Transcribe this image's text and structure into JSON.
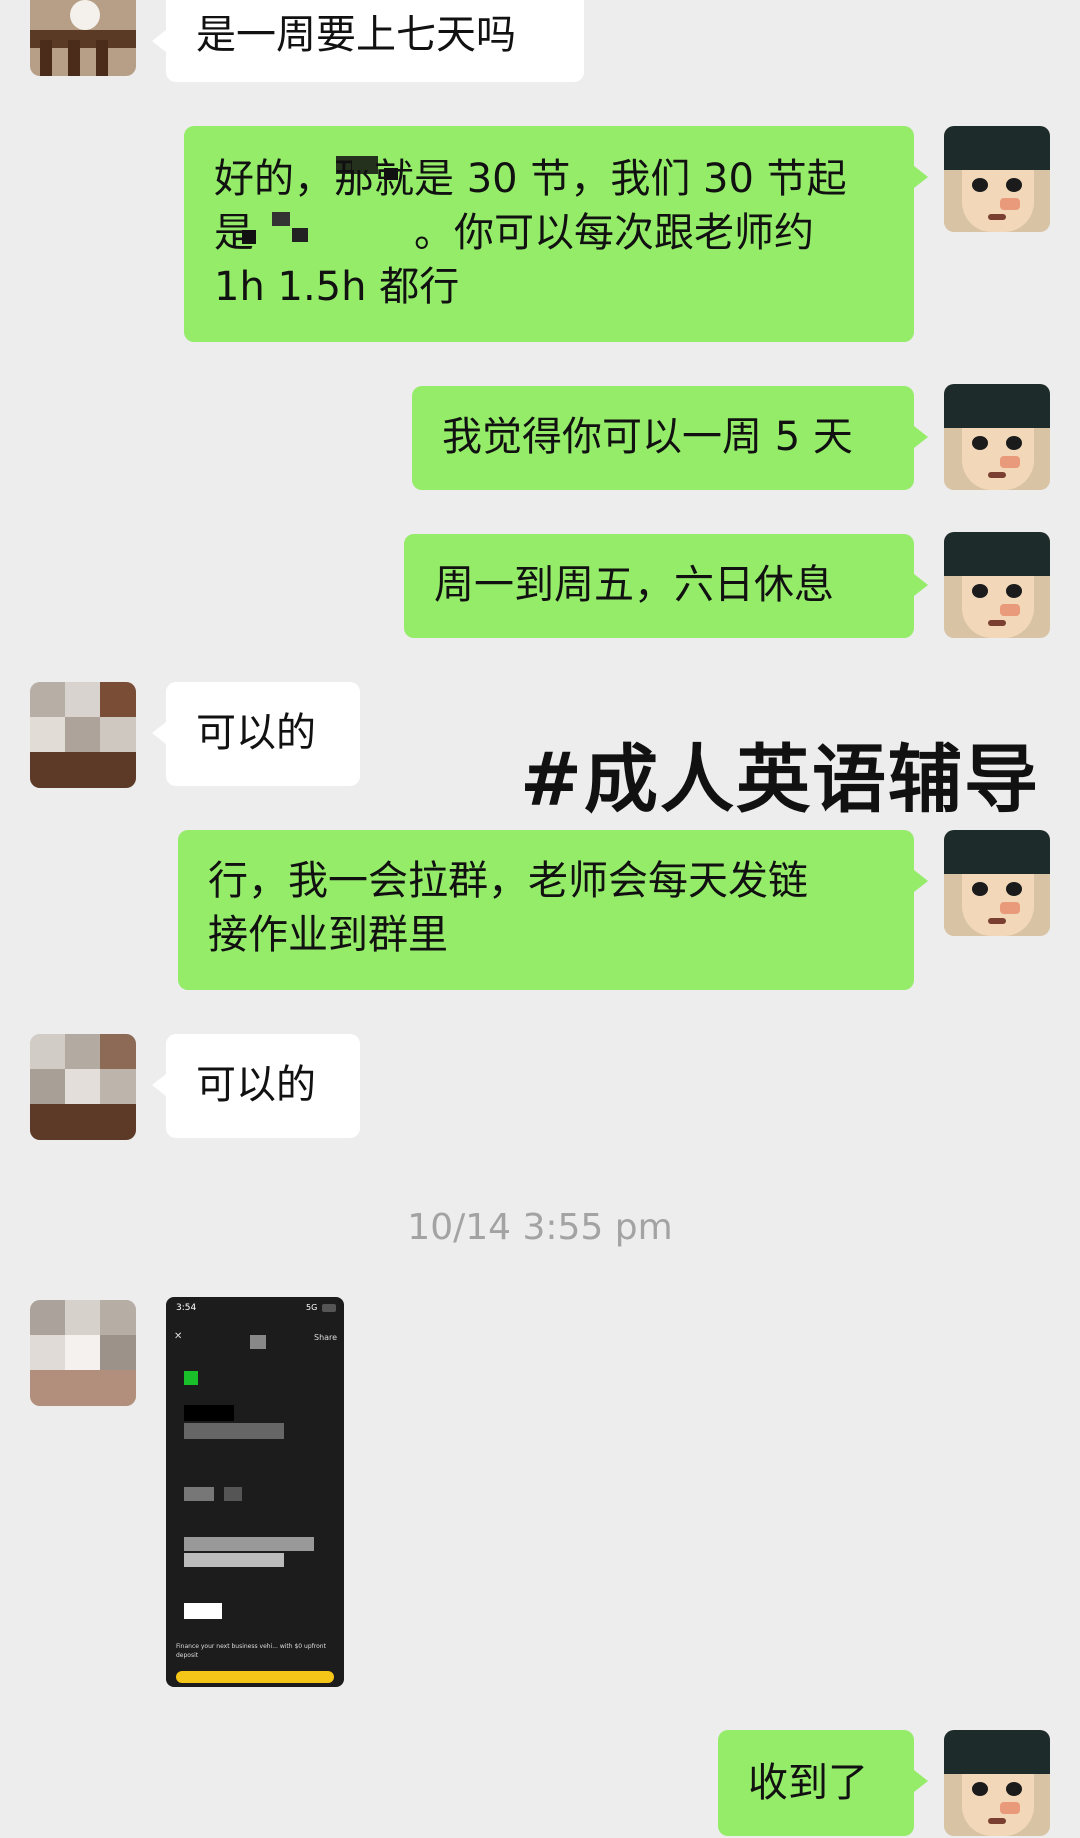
{
  "messages": [
    {
      "side": "left",
      "text": "是一周要上七天吗"
    },
    {
      "side": "right",
      "lines": [
        "好的，那就是 30 节，我们 30 节起",
        "是",
        "。你可以每次跟老师约",
        "1h 1.5h 都行"
      ]
    },
    {
      "side": "right",
      "text": "我觉得你可以一周 5 天"
    },
    {
      "side": "right",
      "text": "周一到周五，六日休息"
    },
    {
      "side": "left",
      "text": "可以的"
    },
    {
      "side": "right",
      "lines": [
        "行，我一会拉群，老师会每天发链",
        "接作业到群里"
      ]
    },
    {
      "side": "left",
      "text": "可以的"
    },
    {
      "side": "right",
      "text": "收到了"
    }
  ],
  "timestamp": "10/14 3:55 pm",
  "overlay_caption": "#成人英语辅导",
  "screenshot_thumb": {
    "time": "3:54",
    "network": "5G",
    "close": "✕",
    "share": "Share",
    "promo": "Finance your next business vehi... with $0 upfront deposit"
  },
  "colors": {
    "background": "#ededed",
    "green_bubble": "#95ec69",
    "white_bubble": "#ffffff",
    "timestamp": "#a3a3a3"
  }
}
